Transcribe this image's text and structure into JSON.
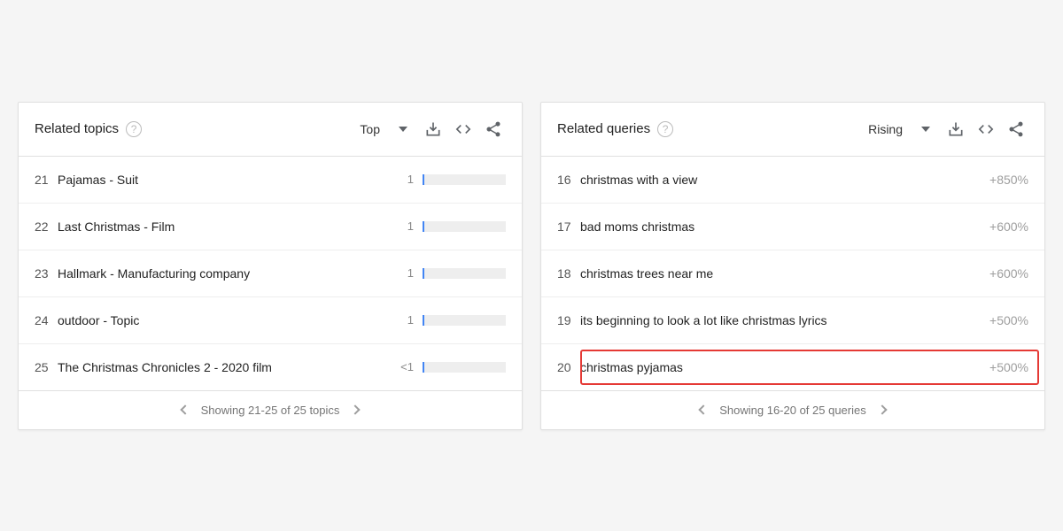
{
  "topics": {
    "title": "Related topics",
    "sort": "Top",
    "rows": [
      {
        "rank": "21",
        "label": "Pajamas - Suit",
        "value": "1"
      },
      {
        "rank": "22",
        "label": "Last Christmas - Film",
        "value": "1"
      },
      {
        "rank": "23",
        "label": "Hallmark - Manufacturing company",
        "value": "1"
      },
      {
        "rank": "24",
        "label": "outdoor - Topic",
        "value": "1"
      },
      {
        "rank": "25",
        "label": "The Christmas Chronicles 2 - 2020 film",
        "value": "<1"
      }
    ],
    "footer": "Showing 21-25 of 25 topics"
  },
  "queries": {
    "title": "Related queries",
    "sort": "Rising",
    "rows": [
      {
        "rank": "16",
        "label": "christmas with a view",
        "pct": "+850%"
      },
      {
        "rank": "17",
        "label": "bad moms christmas",
        "pct": "+600%"
      },
      {
        "rank": "18",
        "label": "christmas trees near me",
        "pct": "+600%"
      },
      {
        "rank": "19",
        "label": "its beginning to look a lot like christmas lyrics",
        "pct": "+500%"
      },
      {
        "rank": "20",
        "label": "christmas pyjamas",
        "pct": "+500%",
        "highlight": true
      }
    ],
    "footer": "Showing 16-20 of 25 queries"
  }
}
